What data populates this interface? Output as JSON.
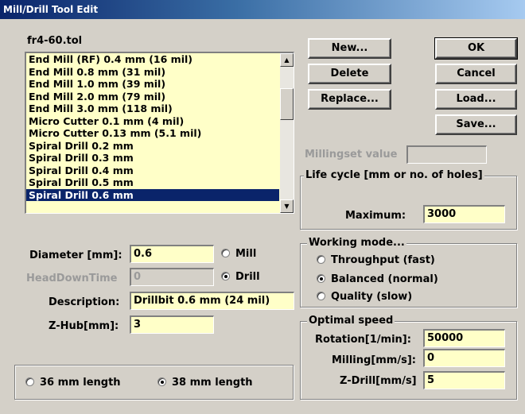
{
  "window": {
    "title": "Mill/Drill Tool Edit"
  },
  "file_name": "fr4-60.tol",
  "tool_list": {
    "items": [
      "End Mill (RF) 0.4 mm (16 mil)",
      "End Mill 0.8 mm (31 mil)",
      "End Mill 1.0 mm (39 mil)",
      "End Mill 2.0 mm (79 mil)",
      "End Mill 3.0 mm (118 mil)",
      "Micro Cutter 0.1 mm (4 mil)",
      "Micro Cutter 0.13 mm (5.1 mil)",
      "Spiral Drill 0.2 mm",
      "Spiral Drill 0.3 mm",
      "Spiral Drill 0.4 mm",
      "Spiral Drill 0.5 mm",
      "Spiral Drill 0.6 mm"
    ],
    "selected": "Spiral Drill 0.6 mm"
  },
  "buttons": {
    "new": "New...",
    "delete": "Delete",
    "replace": "Replace...",
    "ok": "OK",
    "cancel": "Cancel",
    "load": "Load...",
    "save": "Save..."
  },
  "millingset": {
    "label": "Millingset value",
    "value": ""
  },
  "life_cycle": {
    "title": "Life cycle [mm or no. of holes]",
    "max_label": "Maximum:",
    "max_value": "3000"
  },
  "tool_params": {
    "diameter_label": "Diameter [mm]:",
    "diameter_value": "0.6",
    "headdown_label": "HeadDownTime",
    "headdown_value": "0",
    "description_label": "Description:",
    "description_value": "Drillbit 0.6 mm (24 mil)",
    "zhub_label": "Z-Hub[mm]:",
    "zhub_value": "3"
  },
  "tool_type": {
    "mill": "Mill",
    "drill": "Drill",
    "selected": "Drill"
  },
  "working_mode": {
    "title": "Working mode...",
    "options": [
      "Throughput (fast)",
      "Balanced (normal)",
      "Quality (slow)"
    ],
    "selected": "Balanced (normal)"
  },
  "optimal_speed": {
    "title": "Optimal speed",
    "rotation_label": "Rotation[1/min]:",
    "rotation_value": "50000",
    "milling_label": "Milling[mm/s]:",
    "milling_value": "0",
    "zdrill_label": "Z-Drill[mm/s]",
    "zdrill_value": "5"
  },
  "length": {
    "opt36": "36 mm length",
    "opt38": "38 mm length",
    "selected": "38 mm length"
  }
}
